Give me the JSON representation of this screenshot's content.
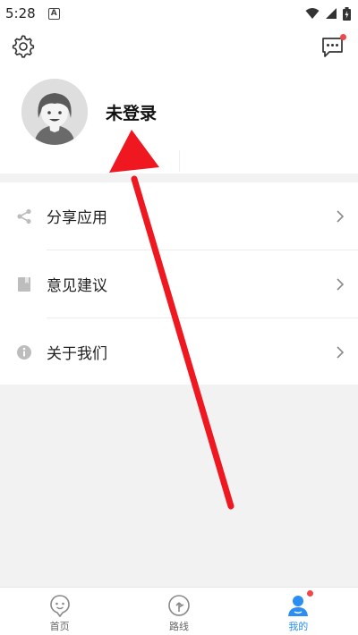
{
  "status_bar": {
    "time": "5:28",
    "notification_glyph": "A",
    "icons": [
      "wifi-icon",
      "signal-icon",
      "battery-charging-icon"
    ]
  },
  "top_bar": {
    "settings_icon": "gear-icon",
    "message_icon": "message-icon",
    "message_badge": true
  },
  "profile": {
    "avatar_icon": "default-avatar-icon",
    "name": "未登录"
  },
  "menu": {
    "items": [
      {
        "label": "分享应用",
        "icon": "share-icon"
      },
      {
        "label": "意见建议",
        "icon": "feedback-icon"
      },
      {
        "label": "关于我们",
        "icon": "info-icon"
      }
    ]
  },
  "tab_bar": {
    "tabs": [
      {
        "label": "首页",
        "icon": "home-icon",
        "active": false
      },
      {
        "label": "路线",
        "icon": "route-icon",
        "active": false
      },
      {
        "label": "我的",
        "icon": "user-icon",
        "active": true,
        "badge": true
      }
    ]
  },
  "annotation": {
    "color": "#f01820",
    "shape": "arrow",
    "points_to": "未登录"
  },
  "colors": {
    "accent": "#2a8ef3",
    "badge": "#f04848",
    "background": "#f2f2f2"
  }
}
